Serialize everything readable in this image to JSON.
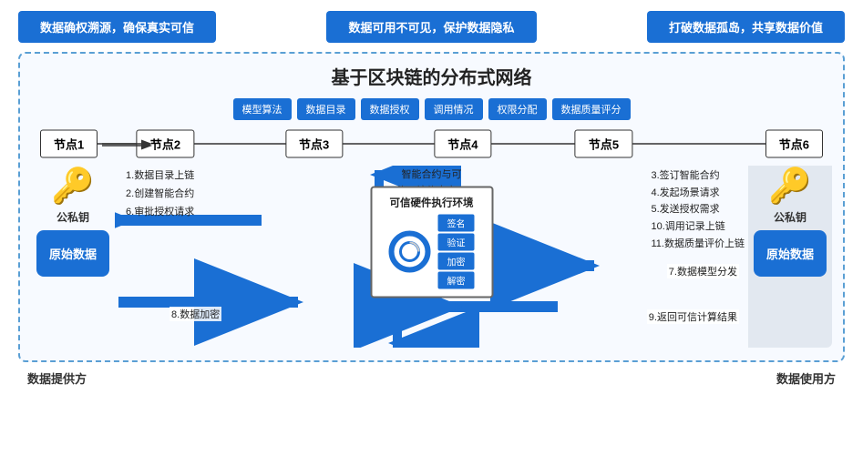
{
  "banners": [
    {
      "text": "数据确权溯源，确保真实可信"
    },
    {
      "text": "数据可用不可见，保护数据隐私"
    },
    {
      "text": "打破数据孤岛，共享数据价值"
    }
  ],
  "diagram": {
    "title": "基于区块链的分布式网络",
    "tags": [
      "模型算法",
      "数据目录",
      "数据授权",
      "调用情况",
      "权限分配",
      "数据质量评分"
    ],
    "nodes": [
      "节点1",
      "节点2",
      "节点3",
      "节点4",
      "节点5",
      "节点6"
    ],
    "provider_label": "数据提供方",
    "user_label": "数据使用方",
    "key_label": "公私钥",
    "data_label": "原始数据",
    "tee": {
      "title": "可信硬件执行环境",
      "ops": [
        "签名",
        "验证",
        "加密",
        "解密"
      ]
    },
    "annotation_left": [
      "1.数据目录上链",
      "2.创建智能合约",
      "6.审批授权请求"
    ],
    "annotation_right_top": "智能合约与可\n信环境信息交互",
    "annotation_right": [
      "3.签订智能合约",
      "4.发起场景请求",
      "5.发送授权需求",
      "10.调用记录上链",
      "11.数据质量评价上链"
    ],
    "arrow_encrypt": "8.数据加密",
    "arrow_model": "7.数据模型分发",
    "arrow_result": "9.返回可信计算结果"
  }
}
